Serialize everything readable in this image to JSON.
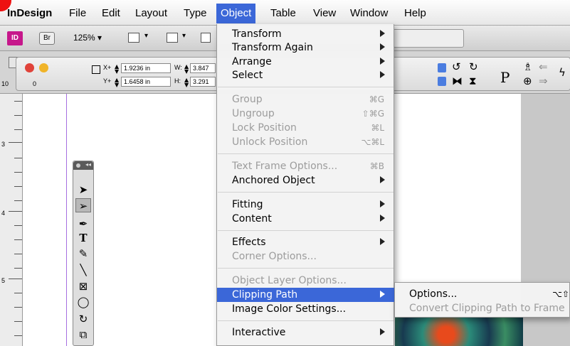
{
  "menubar": {
    "app": "InDesign",
    "items": [
      "File",
      "Edit",
      "Layout",
      "Type",
      "Object",
      "Table",
      "View",
      "Window",
      "Help"
    ]
  },
  "appbar": {
    "id_label": "ID",
    "br_label": "Br",
    "zoom": "125% ▾"
  },
  "control": {
    "x_label": "X+",
    "x_value": "1.9236 in",
    "y_label": "Y+",
    "y_value": "1.6458 in",
    "w_label": "W:",
    "w_value": "3.847",
    "h_label": "H:",
    "h_value": "3.291",
    "p_glyph": "P"
  },
  "ruler": {
    "h_first": "10",
    "h_zero": "0",
    "marks": [
      "3",
      "4",
      "5"
    ]
  },
  "object_menu": {
    "items": [
      {
        "label": "Transform",
        "submenu": true
      },
      {
        "label": "Transform Again",
        "submenu": true
      },
      {
        "label": "Arrange",
        "submenu": true
      },
      {
        "label": "Select",
        "submenu": true
      },
      {
        "label": "Group",
        "shortcut": "⌘G",
        "disabled": true
      },
      {
        "label": "Ungroup",
        "shortcut": "⇧⌘G",
        "disabled": true
      },
      {
        "label": "Lock Position",
        "shortcut": "⌘L",
        "disabled": true
      },
      {
        "label": "Unlock Position",
        "shortcut": "⌥⌘L",
        "disabled": true
      },
      {
        "label": "Text Frame Options...",
        "shortcut": "⌘B",
        "disabled": true
      },
      {
        "label": "Anchored Object",
        "submenu": true
      },
      {
        "label": "Fitting",
        "submenu": true
      },
      {
        "label": "Content",
        "submenu": true
      },
      {
        "label": "Effects",
        "submenu": true
      },
      {
        "label": "Corner Options...",
        "disabled": true
      },
      {
        "label": "Object Layer Options...",
        "disabled": true
      },
      {
        "label": "Clipping Path",
        "submenu": true,
        "highlighted": true
      },
      {
        "label": "Image Color Settings..."
      },
      {
        "label": "Interactive",
        "submenu": true
      }
    ]
  },
  "clipping_submenu": {
    "options_label": "Options...",
    "options_shortcut": "⌥⇧",
    "convert_label": "Convert Clipping Path to Frame"
  },
  "tools": [
    "selection-arrow",
    "direct-selection",
    "pen",
    "type",
    "pencil",
    "line",
    "rectangle-frame",
    "ellipse",
    "rotate",
    "scale"
  ],
  "colors": {
    "highlight": "#3b67d8",
    "id_badge": "#c6178b",
    "guide": "#a66fe0"
  }
}
